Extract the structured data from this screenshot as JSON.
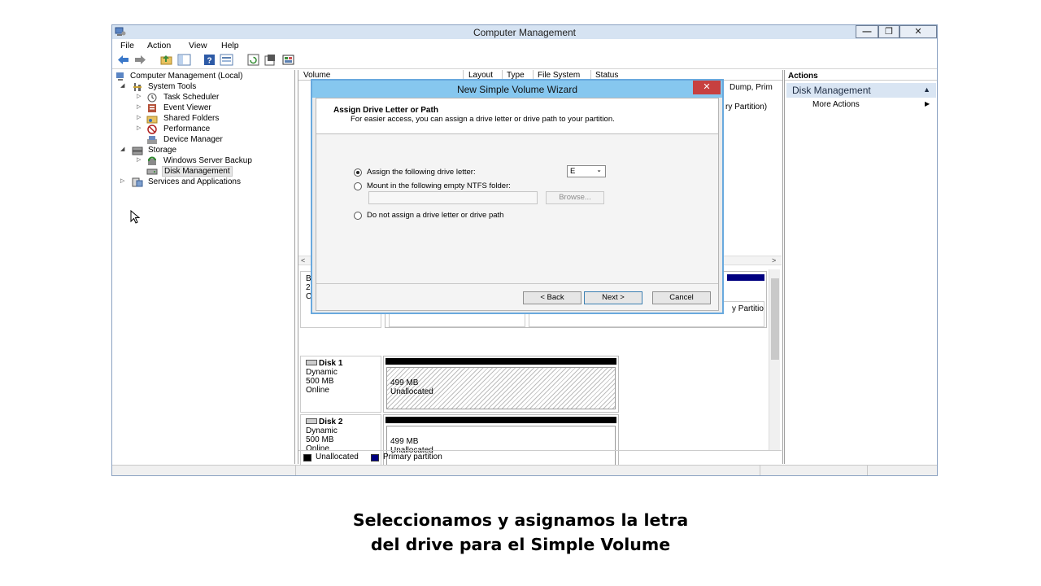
{
  "window": {
    "title": "Computer Management",
    "controls": {
      "minimize": "—",
      "maximize": "❐",
      "close": "✕"
    }
  },
  "menu": [
    "File",
    "Action",
    "View",
    "Help"
  ],
  "toolbar_icons": [
    "back-arrow-icon",
    "forward-arrow-icon",
    "folder-up-icon",
    "console-tree-icon",
    "help-icon",
    "properties-icon",
    "refresh-icon",
    "properties-page-icon",
    "export-icon"
  ],
  "tree": {
    "root": "Computer Management (Local)",
    "system_tools": "System Tools",
    "task_scheduler": "Task Scheduler",
    "event_viewer": "Event Viewer",
    "shared_folders": "Shared Folders",
    "performance": "Performance",
    "device_manager": "Device Manager",
    "storage": "Storage",
    "windows_server_backup": "Windows Server Backup",
    "disk_management": "Disk Management",
    "services_apps": "Services and Applications"
  },
  "volume_list": {
    "columns": [
      "Volume",
      "Layout",
      "Type",
      "File System",
      "Status"
    ],
    "partial_rows": [
      "Dump, Prim",
      "ry Partition)"
    ]
  },
  "disks": {
    "disk0_partial": {
      "line1": "B",
      "line2": "2",
      "line3": "C",
      "right_text": "y Partitio"
    },
    "disk1": {
      "name": "Disk 1",
      "type": "Dynamic",
      "size": "500 MB",
      "status": "Online",
      "part_size": "499 MB",
      "part_state": "Unallocated"
    },
    "disk2": {
      "name": "Disk 2",
      "type": "Dynamic",
      "size": "500 MB",
      "status": "Online",
      "part_size": "499 MB",
      "part_state": "Unallocated"
    }
  },
  "legend": {
    "unallocated": "Unallocated",
    "primary": "Primary partition",
    "unallocated_color": "#000000",
    "primary_color": "#000080"
  },
  "actions": {
    "header": "Actions",
    "section": "Disk Management",
    "more": "More Actions"
  },
  "wizard": {
    "title": "New Simple Volume Wizard",
    "close": "✕",
    "heading": "Assign Drive Letter or Path",
    "subheading": "For easier access, you can assign a drive letter or drive path to your partition.",
    "option_assign": "Assign the following drive letter:",
    "option_mount": "Mount in the following empty NTFS folder:",
    "option_none": "Do not assign a drive letter or drive path",
    "drive_letter": "E",
    "browse": "Browse...",
    "back": "< Back",
    "next": "Next >",
    "cancel": "Cancel",
    "selected_option": "assign"
  },
  "caption": {
    "line1": "Seleccionamos y asignamos la letra",
    "line2": "del drive para el Simple Volume"
  }
}
